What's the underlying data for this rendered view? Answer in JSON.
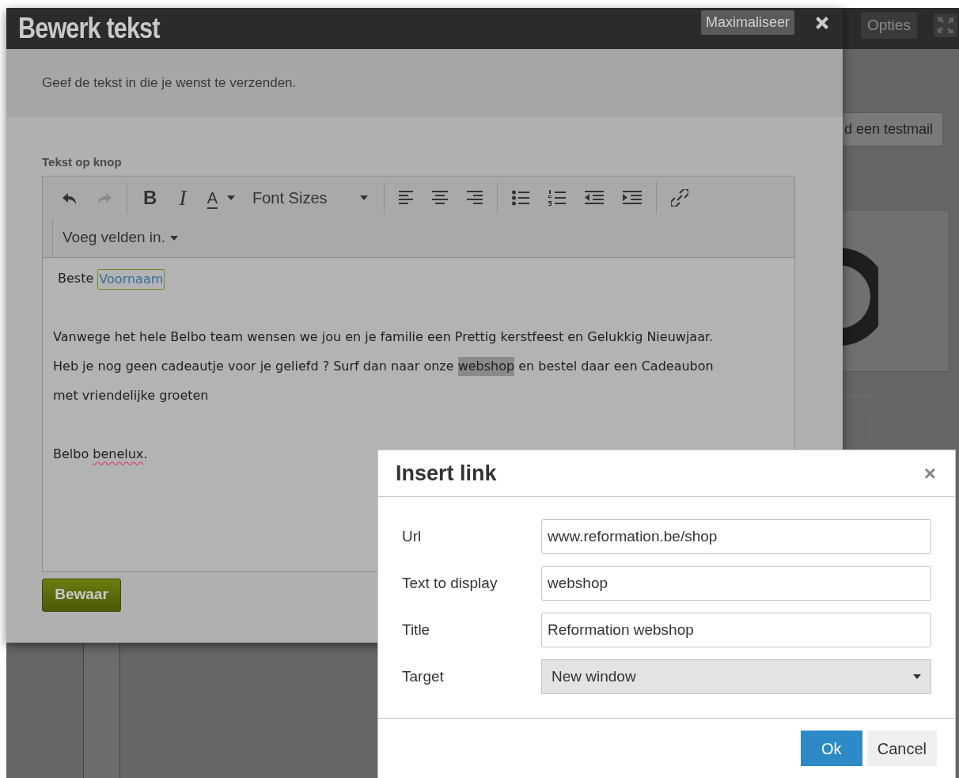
{
  "background": {
    "options_button": "Opties",
    "test_button": "d een testmail"
  },
  "edit_dialog": {
    "title": "Bewerk tekst",
    "maximize_button": "Maximaliseer",
    "intro": "Geef de tekst in die je wenst te verzenden.",
    "field_label": "Tekst op knop",
    "toolbar": [
      {
        "kind": "undo",
        "disabled": false
      },
      {
        "kind": "redo",
        "disabled": true
      },
      {
        "kind": "sep"
      },
      {
        "kind": "bold",
        "label": "B"
      },
      {
        "kind": "italic",
        "label": "I"
      },
      {
        "kind": "color",
        "label": "A"
      },
      {
        "kind": "select",
        "label": "Font Sizes"
      },
      {
        "kind": "sep"
      },
      {
        "kind": "align-left"
      },
      {
        "kind": "align-center"
      },
      {
        "kind": "align-right"
      },
      {
        "kind": "sep"
      },
      {
        "kind": "bullets"
      },
      {
        "kind": "numbers"
      },
      {
        "kind": "outdent"
      },
      {
        "kind": "indent"
      },
      {
        "kind": "sep"
      },
      {
        "kind": "link"
      }
    ],
    "insert_fields": "Voeg velden in.",
    "content": [
      {
        "lines": [
          [
            {
              "kind": "text",
              "text": "Beste "
            },
            {
              "kind": "field",
              "text": "Voornaam"
            }
          ]
        ]
      },
      {
        "lines": [
          [
            {
              "kind": "text",
              "text": "Vanwege het hele Belbo team wensen we jou en je familie een Prettig kerstfeest en Gelukkig Nieuwjaar."
            }
          ],
          [
            {
              "kind": "text",
              "text": "Heb je nog geen cadeautje voor je geliefd ? Surf dan naar onze "
            },
            {
              "kind": "selected",
              "text": "webshop"
            },
            {
              "kind": "text",
              "text": " en bestel daar een Cadeaubon"
            }
          ],
          [
            {
              "kind": "text",
              "text": "met vriendelijke groeten"
            }
          ]
        ]
      },
      {
        "lines": [
          [
            {
              "kind": "text",
              "text": "Belbo "
            },
            {
              "kind": "misspelled",
              "text": "benelux"
            },
            {
              "kind": "text",
              "text": "."
            }
          ]
        ]
      }
    ],
    "save_button": "Bewaar"
  },
  "link_dialog": {
    "title": "Insert link",
    "close": "×",
    "fields": [
      {
        "kind": "input",
        "label": "Url",
        "value": "www.reformation.be/shop"
      },
      {
        "kind": "input",
        "label": "Text to display",
        "value": "webshop"
      },
      {
        "kind": "input",
        "label": "Title",
        "value": "Reformation webshop"
      },
      {
        "kind": "select",
        "label": "Target",
        "value": "New window"
      }
    ],
    "buttons": [
      {
        "label": "Ok",
        "primary": true
      },
      {
        "label": "Cancel",
        "primary": false
      }
    ]
  }
}
